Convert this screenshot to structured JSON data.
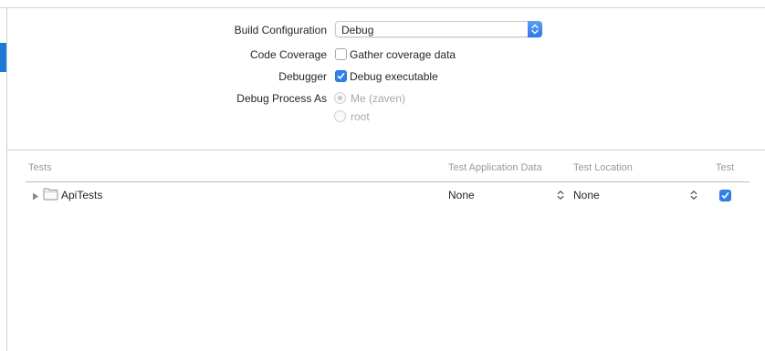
{
  "form": {
    "build_configuration": {
      "label": "Build Configuration",
      "value": "Debug"
    },
    "code_coverage": {
      "label": "Code Coverage",
      "checkbox_label": "Gather coverage data",
      "checked": false
    },
    "debugger": {
      "label": "Debugger",
      "checkbox_label": "Debug executable",
      "checked": true
    },
    "debug_process_as": {
      "label": "Debug Process As",
      "options": [
        {
          "label": "Me (zaven)",
          "selected": true
        },
        {
          "label": "root",
          "selected": false
        }
      ]
    }
  },
  "tests_table": {
    "columns": [
      "Tests",
      "Test Application Data",
      "Test Location",
      "Test"
    ],
    "rows": [
      {
        "name": "ApiTests",
        "application_data": "None",
        "location": "None",
        "enabled": true
      }
    ]
  },
  "colors": {
    "accent": "#2f82ee",
    "sidebar_accent": "#1f78d4",
    "disabled_text": "#a8a8a8"
  },
  "icons": [
    "disclosure-triangle-icon",
    "folder-icon",
    "popup-arrows-icon",
    "checkmark-icon",
    "stepper-icon"
  ]
}
